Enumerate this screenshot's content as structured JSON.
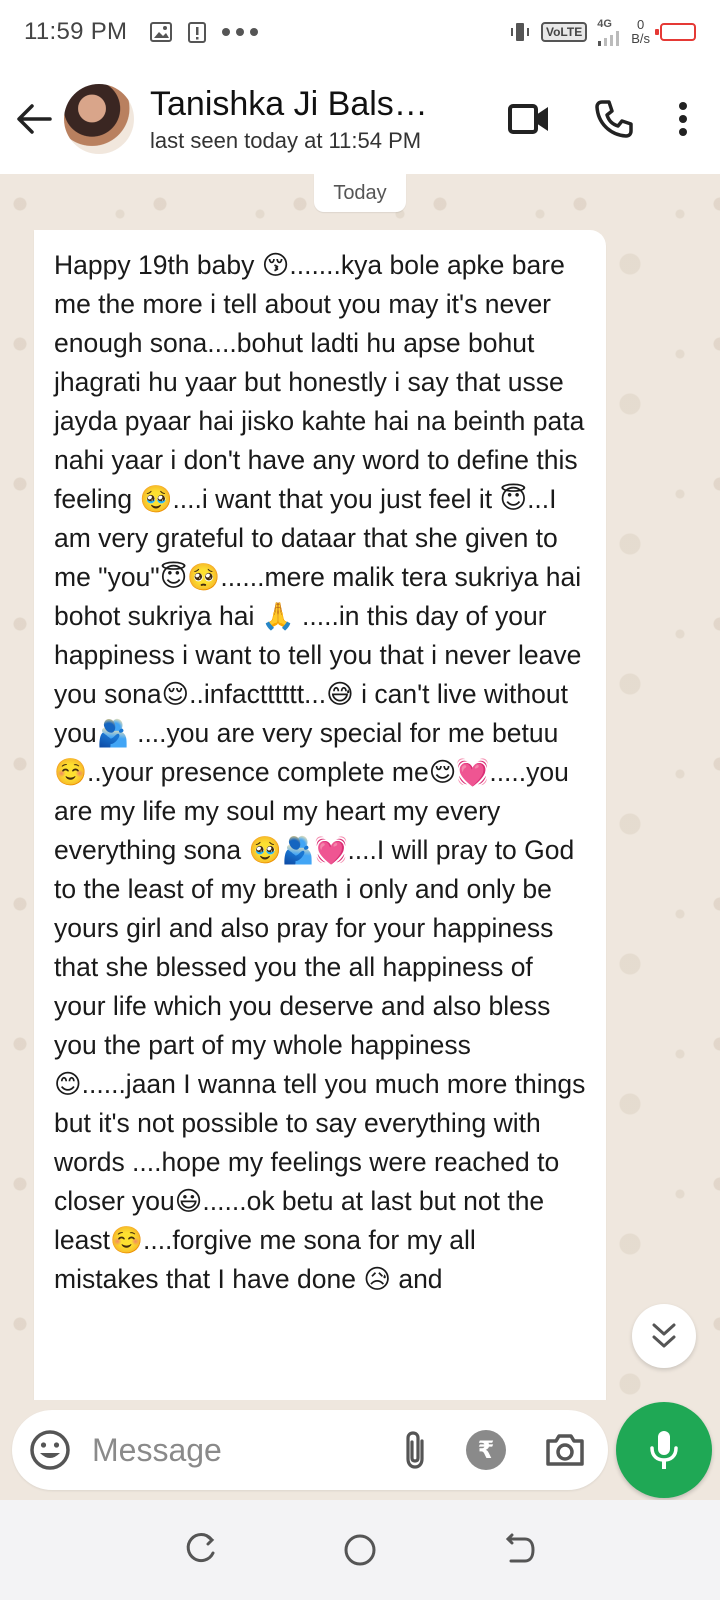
{
  "status_bar": {
    "time": "11:59 PM",
    "left_icons": [
      "image-icon",
      "alert-icon",
      "more-dots-icon"
    ],
    "volte": "VoLTE",
    "network": "4G",
    "speed_value": "0",
    "speed_unit": "B/s",
    "battery_color": "#e53935"
  },
  "header": {
    "contact_name": "Tanishka Ji Bals…",
    "last_seen": "last seen today at 11:54 PM"
  },
  "chat": {
    "date_chip": "Today",
    "message": "Happy 19th baby 😚.......kya bole apke bare me the more i tell about you may it's never enough sona....bohut ladti hu apse bohut jhagrati hu yaar but honestly i say that usse jayda pyaar hai jisko kahte hai na beinth pata nahi yaar i don't have any word to define this feeling 🥹....i want that you just feel it 😇...I am very grateful to dataar that she given to me \"you\"😇🥺......mere malik tera sukriya hai bohot sukriya hai 🙏 .....in this day of your happiness i want to tell you that i never leave you sona😌..infactttttt...😅 i can't live without you🫂 ....you are very special for me betuu☺️..your presence complete me😌💓.....you are my life my soul my heart my every everything sona 🥹🫂💓....I will pray to God to the least of my breath i only and only be yours girl and also pray for your happiness that she blessed you the all happiness of your life which you deserve and also bless you the part of my whole happiness 😊......jaan I wanna tell you much more things but it's not possible to say everything with words ....hope my feelings were reached to closer you😃......ok betu at last but not the least☺️....forgive me sona for my all mistakes that I have done 😥 and"
  },
  "input": {
    "placeholder": "Message",
    "rupee_symbol": "₹"
  },
  "colors": {
    "accent": "#1fa855",
    "chat_background": "#efe7de",
    "bubble": "#ffffff"
  }
}
